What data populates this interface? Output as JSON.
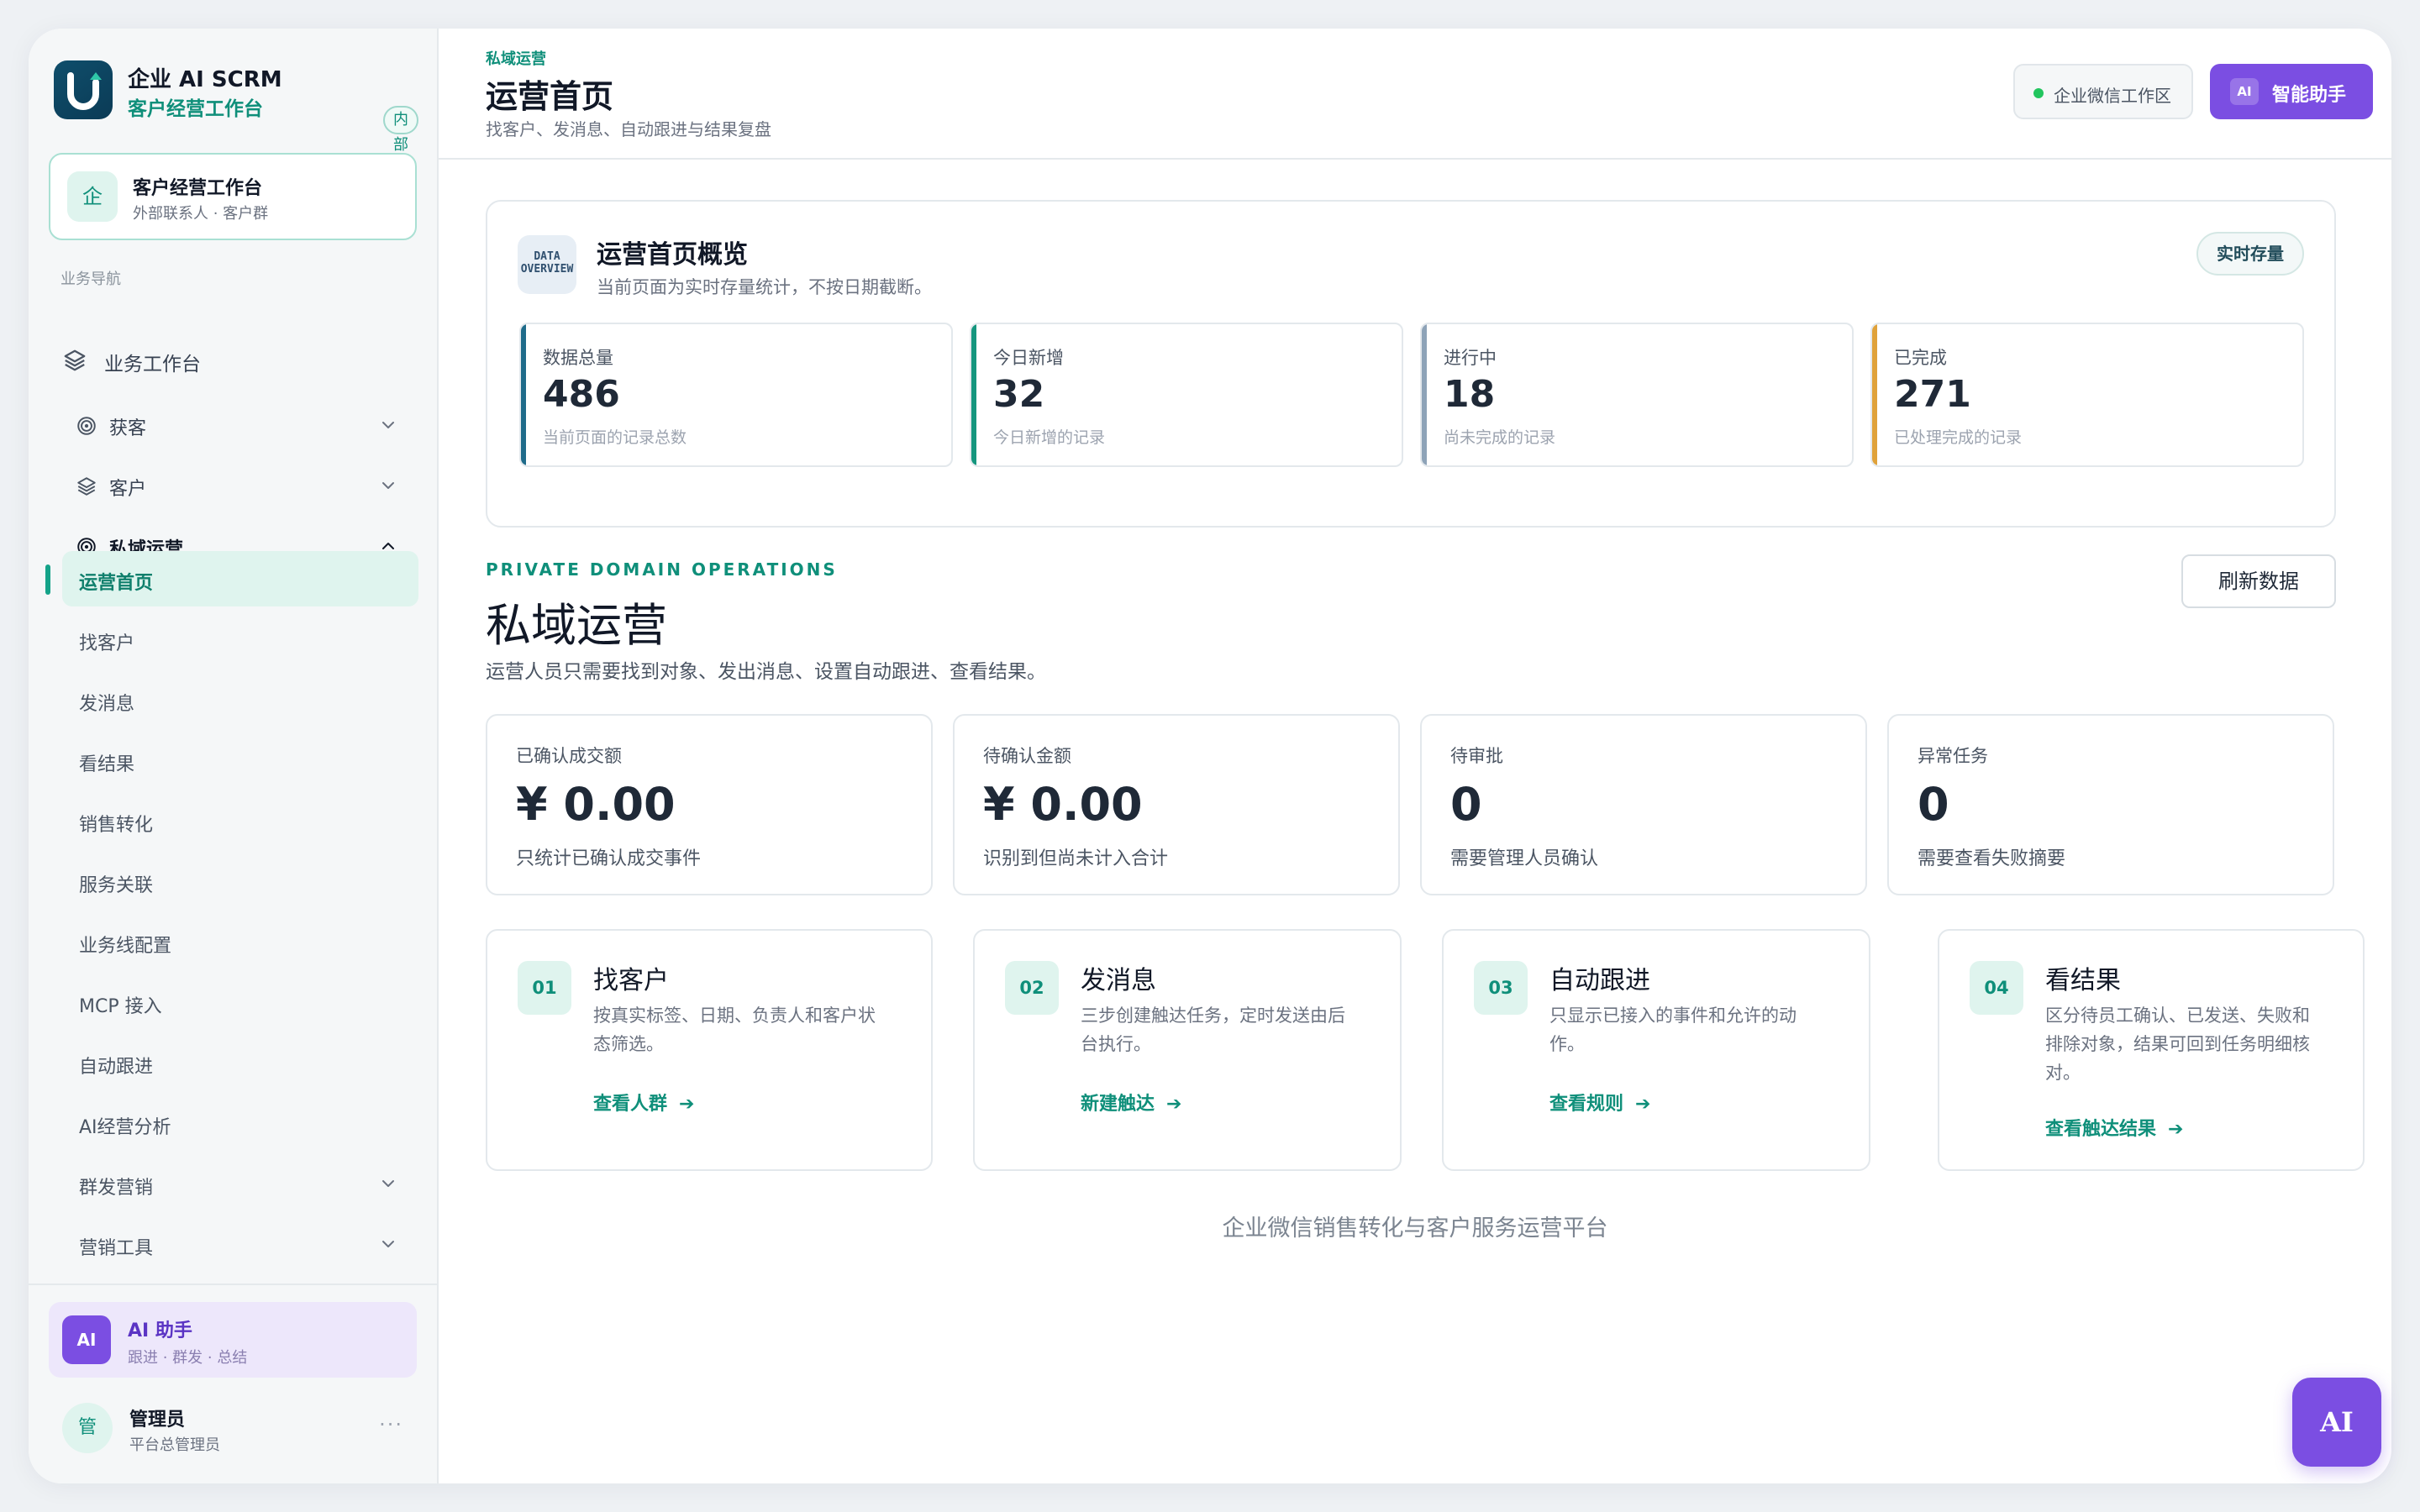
{
  "brand": {
    "name": "企业 AI SCRM",
    "subtitle": "客户经营工作台",
    "badge": "内部"
  },
  "workspace": {
    "icon_char": "企",
    "title": "客户经营工作台",
    "subtitle": "外部联系人 · 客户群"
  },
  "sidebar": {
    "section_label": "业务导航",
    "top_item": {
      "label": "业务工作台",
      "icon": "layers-icon"
    },
    "groups": [
      {
        "label": "获客",
        "icon": "target-icon",
        "expanded": false
      },
      {
        "label": "客户",
        "icon": "layers-icon",
        "expanded": false
      },
      {
        "label": "私域运营",
        "icon": "target-icon",
        "expanded": true
      }
    ],
    "sub_items": [
      {
        "label": "运营首页",
        "active": true
      },
      {
        "label": "找客户"
      },
      {
        "label": "发消息"
      },
      {
        "label": "看结果"
      },
      {
        "label": "销售转化"
      },
      {
        "label": "服务关联"
      },
      {
        "label": "业务线配置"
      },
      {
        "label": "MCP 接入"
      },
      {
        "label": "自动跟进"
      },
      {
        "label": "AI经营分析"
      },
      {
        "label": "群发营销",
        "has_children": true
      },
      {
        "label": "营销工具",
        "has_children": true
      }
    ],
    "ai_card": {
      "icon_text": "AI",
      "title": "AI 助手",
      "subtitle": "跟进 · 群发 · 总结"
    },
    "user": {
      "avatar_char": "管",
      "name": "管理员",
      "role": "平台总管理员",
      "more": "···"
    }
  },
  "header": {
    "breadcrumb": "私域运营",
    "title": "运营首页",
    "subtitle": "找客户、发消息、自动跟进与结果复盘",
    "env_label": "企业微信工作区",
    "env_status_color": "#22c55e",
    "assistant_icon": "AI",
    "assistant_label": "智能助手"
  },
  "overview": {
    "icon_lines": [
      "DATA",
      "OVERVIEW"
    ],
    "title": "运营首页概览",
    "subtitle": "当前页面为实时存量统计，不按日期截断。",
    "chip": "实时存量",
    "stats": [
      {
        "label": "数据总量",
        "value": "486",
        "note": "当前页面的记录总数",
        "accent": "#1f6b8a"
      },
      {
        "label": "今日新增",
        "value": "32",
        "note": "今日新增的记录",
        "accent": "#15967e"
      },
      {
        "label": "进行中",
        "value": "18",
        "note": "尚未完成的记录",
        "accent": "#8ea3b8"
      },
      {
        "label": "已完成",
        "value": "271",
        "note": "已处理完成的记录",
        "accent": "#e0a23a"
      }
    ]
  },
  "section": {
    "eyebrow": "PRIVATE DOMAIN OPERATIONS",
    "title": "私域运营",
    "subtitle": "运营人员只需要找到对象、发出消息、设置自动跟进、查看结果。",
    "refresh_label": "刷新数据"
  },
  "kpis": [
    {
      "label": "已确认成交额",
      "value": "¥ 0.00",
      "note": "只统计已确认成交事件"
    },
    {
      "label": "待确认金额",
      "value": "¥ 0.00",
      "note": "识别到但尚未计入合计"
    },
    {
      "label": "待审批",
      "value": "0",
      "note": "需要管理人员确认"
    },
    {
      "label": "异常任务",
      "value": "0",
      "note": "需要查看失败摘要"
    }
  ],
  "steps": [
    {
      "num": "01",
      "title": "找客户",
      "desc": [
        "按真实标签、日期、负责人和客户状",
        "态筛选。"
      ],
      "link": "查看人群",
      "arrow": "➔"
    },
    {
      "num": "02",
      "title": "发消息",
      "desc": [
        "三步创建触达任务，定时发送由后",
        "台执行。"
      ],
      "link": "新建触达",
      "arrow": "➔"
    },
    {
      "num": "03",
      "title": "自动跟进",
      "desc": [
        "只显示已接入的事件和允许的动",
        "作。"
      ],
      "link": "查看规则",
      "arrow": "➔"
    },
    {
      "num": "04",
      "title": "看结果",
      "desc": [
        "区分待员工确认、已发送、失败和",
        "排除对象，结果可回到任务明细核",
        "对。"
      ],
      "link": "查看触达结果",
      "arrow": "➔"
    }
  ],
  "footer": "企业微信销售转化与客户服务运营平台",
  "fab_label": "AI",
  "colors": {
    "primary": "#0f8f7a",
    "ai_purple": "#7b4ee2",
    "brand_dark": "#0f4e6b"
  }
}
